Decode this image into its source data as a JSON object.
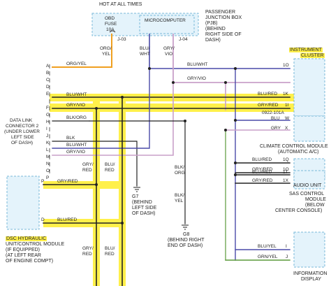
{
  "header": {
    "hot_at_all_times": "HOT AT ALL TIMES",
    "obd_fuse": "OBD",
    "fuse_word": "FUSE",
    "fuse_rating": "10A",
    "microcomputer": "MICROCOMPUTER",
    "connector_j03": "J-03",
    "connector_j04": "J-04",
    "pjb_lines": [
      "PASSENGER",
      "JUNCTION BOX",
      "(PJB)",
      "(BEHIND",
      "RIGHT SIDE OF",
      "DASH)"
    ]
  },
  "left_connector": {
    "pins": [
      "A",
      "B",
      "C",
      "D",
      "E",
      "F",
      "G",
      "H",
      "I",
      "J",
      "K",
      "L",
      "M",
      "N",
      "O",
      "P"
    ],
    "label_lines": [
      "DATA LINK",
      "CONNECTOR 2",
      "(UNDER LOWER",
      "LEFT SIDE",
      "OF DASH)"
    ]
  },
  "wires": {
    "org_yel": "ORG/YEL",
    "org_yel_vert": [
      "ORG/",
      "YEL"
    ],
    "blu_wht_vert": [
      "BLU/",
      "WHT"
    ],
    "gry_vio_vert": [
      "GRY/",
      "VIO"
    ],
    "blu_wht_top": "BLU/WHT",
    "gry_vio_top": "GRY/VIO",
    "blu_wht_f": "BLU/WHT",
    "gry_vio_f": "GRY/VIO",
    "blu_red_k": "BLU/RED",
    "gry_red_i": "GRY/RED",
    "splice_code": "0922-101A",
    "blu_w": "BLU",
    "gry_x": "GRY",
    "blk_org_left": "BLK/ORG",
    "blk_left": "BLK",
    "blu_wht_left": "BLU/WHT",
    "gry_vio_left": "GRY/VIO",
    "blk_org_vert": [
      "BLK/",
      "ORG"
    ],
    "blk_yel_vert": [
      "BLK/",
      "YEL"
    ],
    "gry_red_vert": [
      "GRY/",
      "RED"
    ],
    "blu_red_vert": [
      "BLU/",
      "RED"
    ],
    "cc_blu_red": "BLU/RED",
    "cc_gry_red": "GRY/RED",
    "sas_blu_red": "BLU/RED",
    "sas_gry_red": "GRY/RED",
    "dsc_gry_red": "GRY/RED",
    "dsc_blu_red": "BLU/RED",
    "info_blu_yel": "BLU/YEL",
    "info_grn_yel": "GRN/YEL"
  },
  "modules": {
    "instrument_cluster": [
      "INSTRUMENT",
      "CLUSTER"
    ],
    "cluster_pins": [
      "1O",
      "1K",
      "1I"
    ],
    "climate": [
      "CLIMATE CONTROL MODULE",
      "(AUTOMATIC A/C)"
    ],
    "climate_pins": [
      "W",
      "X"
    ],
    "audio": "AUDIO UNIT",
    "audio_pins": [
      "1Q",
      "1O"
    ],
    "sas": [
      "SAS CONTROL",
      "MODULE",
      "(BELOW",
      "CENTER CONSOLE)"
    ],
    "sas_pins": [
      "1T",
      "1X"
    ],
    "info": [
      "INFORMATION",
      "DISPLAY"
    ],
    "info_pins": [
      "I",
      "J"
    ],
    "dsc_title": "DSC HYDRAULIC",
    "dsc_lines": [
      "UNIT/CONTROL MODULE",
      "(IF EQUIPPED)",
      "(AT LEFT REAR",
      "OF ENGINE COMPT)"
    ],
    "dsc_pins": [
      "P",
      "D"
    ]
  },
  "grounds": {
    "g7_lines": [
      "G7",
      "(BEHIND",
      "LEFT SIDE",
      "OF DASH)"
    ],
    "g8_lines": [
      "G8",
      "(BEHIND RIGHT",
      "END OF DASH)"
    ]
  },
  "colors": {
    "highlight": "#fff04a",
    "org_yel": "#f0a020",
    "gry_vio": "#c9a0c9",
    "blu_wht": "#4a4aa8",
    "blk": "#222222",
    "blu": "#4a4aa8",
    "grn_yel": "#5a9a3a",
    "dashed_box": "#7ab8d8",
    "box_fill": "#e4f3fb"
  }
}
